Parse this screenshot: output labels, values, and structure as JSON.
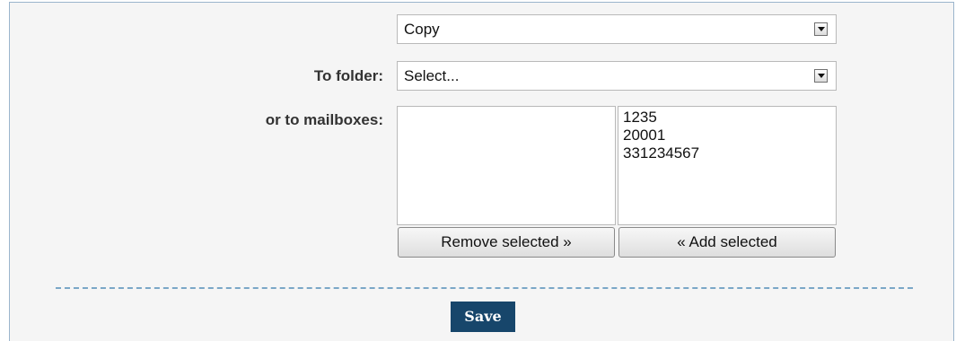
{
  "action_select": {
    "value": "Copy"
  },
  "to_folder": {
    "label": "To folder:",
    "value": "Select..."
  },
  "mailboxes": {
    "label": "or to mailboxes:",
    "selected_list": [],
    "available_list": [
      "1235",
      "20001",
      "331234567"
    ],
    "remove_button": "Remove selected »",
    "add_button": "« Add selected"
  },
  "form": {
    "save_label": "Save"
  },
  "icons": {
    "dropdown": "chevron-down-icon"
  }
}
